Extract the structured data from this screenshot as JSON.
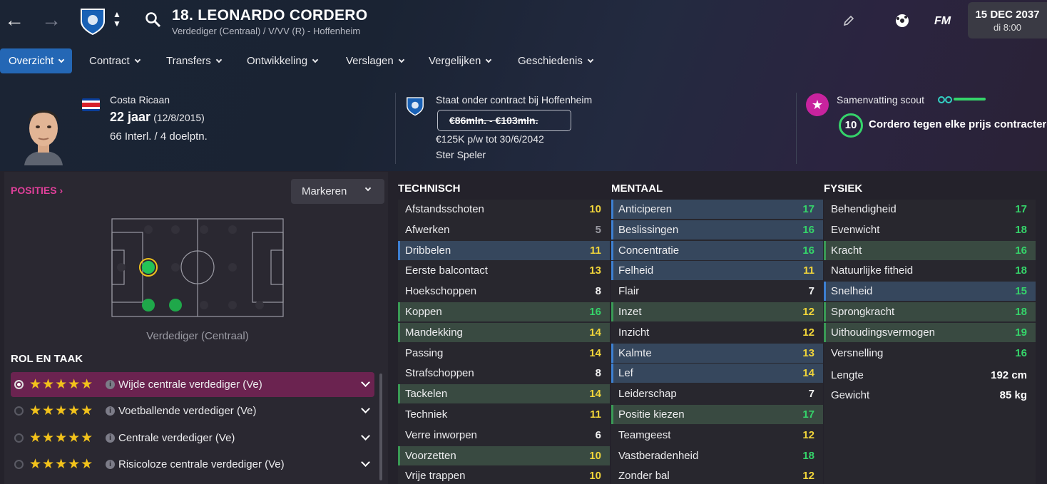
{
  "header": {
    "title": "18. LEONARDO CORDERO",
    "subtitle": "Verdediger (Centraal) / V/VV (R) - Hoffenheim",
    "game_logo": "FM",
    "date": "15 DEC 2037",
    "time": "di 8:00"
  },
  "tabs": [
    {
      "label": "Overzicht",
      "active": true
    },
    {
      "label": "Contract"
    },
    {
      "label": "Transfers"
    },
    {
      "label": "Ontwikkeling"
    },
    {
      "label": "Verslagen"
    },
    {
      "label": "Vergelijken"
    },
    {
      "label": "Geschiedenis"
    }
  ],
  "profile": {
    "nationality": "Costa Ricaan",
    "age": "22 jaar",
    "dob": "(12/8/2015)",
    "caps": "66 Interl. / 4 doelptn."
  },
  "contract": {
    "status": "Staat onder contract bij Hoffenheim",
    "value": "€86mln. - €103mln.",
    "wage": "€125K p/w tot 30/6/2042",
    "type": "Ster Speler"
  },
  "scout": {
    "title": "Samenvatting scout",
    "rating": "10",
    "summary": "Cordero tegen elke prijs contracteren"
  },
  "positions": {
    "title": "POSITIES",
    "mark_button": "Markeren",
    "position_label": "Verdediger (Centraal)"
  },
  "roles": {
    "title": "ROL EN TAAK",
    "items": [
      {
        "stars": "★★★★★",
        "label": "Wijde centrale verdediger (Ve)",
        "selected": true
      },
      {
        "stars": "★★★★★",
        "label": "Voetballende verdediger (Ve)"
      },
      {
        "stars": "★★★★★",
        "label": "Centrale verdediger (Ve)"
      },
      {
        "stars": "★★★★★",
        "label": "Risicoloze centrale verdediger (Ve)"
      }
    ]
  },
  "attributes": {
    "technical_title": "TECHNISCH",
    "mental_title": "MENTAAL",
    "physical_title": "FYSIEK",
    "technical": [
      {
        "name": "Afstandsschoten",
        "value": 10,
        "hl": ""
      },
      {
        "name": "Afwerken",
        "value": 5,
        "hl": ""
      },
      {
        "name": "Dribbelen",
        "value": 11,
        "hl": "b"
      },
      {
        "name": "Eerste balcontact",
        "value": 13,
        "hl": ""
      },
      {
        "name": "Hoekschoppen",
        "value": 8,
        "hl": ""
      },
      {
        "name": "Koppen",
        "value": 16,
        "hl": "g"
      },
      {
        "name": "Mandekking",
        "value": 14,
        "hl": "g"
      },
      {
        "name": "Passing",
        "value": 14,
        "hl": ""
      },
      {
        "name": "Strafschoppen",
        "value": 8,
        "hl": ""
      },
      {
        "name": "Tackelen",
        "value": 14,
        "hl": "g"
      },
      {
        "name": "Techniek",
        "value": 11,
        "hl": ""
      },
      {
        "name": "Verre inworpen",
        "value": 6,
        "hl": ""
      },
      {
        "name": "Voorzetten",
        "value": 10,
        "hl": "g"
      },
      {
        "name": "Vrije trappen",
        "value": 10,
        "hl": ""
      }
    ],
    "mental": [
      {
        "name": "Anticiperen",
        "value": 17,
        "hl": "b"
      },
      {
        "name": "Beslissingen",
        "value": 16,
        "hl": "b"
      },
      {
        "name": "Concentratie",
        "value": 16,
        "hl": "b"
      },
      {
        "name": "Felheid",
        "value": 11,
        "hl": "b"
      },
      {
        "name": "Flair",
        "value": 7,
        "hl": ""
      },
      {
        "name": "Inzet",
        "value": 12,
        "hl": "g"
      },
      {
        "name": "Inzicht",
        "value": 12,
        "hl": ""
      },
      {
        "name": "Kalmte",
        "value": 13,
        "hl": "b"
      },
      {
        "name": "Lef",
        "value": 14,
        "hl": "b"
      },
      {
        "name": "Leiderschap",
        "value": 7,
        "hl": ""
      },
      {
        "name": "Positie kiezen",
        "value": 17,
        "hl": "g"
      },
      {
        "name": "Teamgeest",
        "value": 12,
        "hl": ""
      },
      {
        "name": "Vastberadenheid",
        "value": 18,
        "hl": ""
      },
      {
        "name": "Zonder bal",
        "value": 12,
        "hl": ""
      }
    ],
    "physical": [
      {
        "name": "Behendigheid",
        "value": 17,
        "hl": ""
      },
      {
        "name": "Evenwicht",
        "value": 18,
        "hl": ""
      },
      {
        "name": "Kracht",
        "value": 16,
        "hl": "g"
      },
      {
        "name": "Natuurlijke fitheid",
        "value": 18,
        "hl": ""
      },
      {
        "name": "Snelheid",
        "value": 15,
        "hl": "b"
      },
      {
        "name": "Sprongkracht",
        "value": 18,
        "hl": "g"
      },
      {
        "name": "Uithoudingsvermogen",
        "value": 19,
        "hl": "g"
      },
      {
        "name": "Versnelling",
        "value": 16,
        "hl": ""
      }
    ],
    "extra": [
      {
        "name": "Lengte",
        "value": "192 cm"
      },
      {
        "name": "Gewicht",
        "value": "85 kg"
      }
    ]
  },
  "colors": {
    "accent": "#2467b5",
    "high": "#35d46a",
    "mid": "#f1d53a",
    "low": "#9a9aa2",
    "positions": "#e0409a",
    "scout": "#c8239e"
  }
}
